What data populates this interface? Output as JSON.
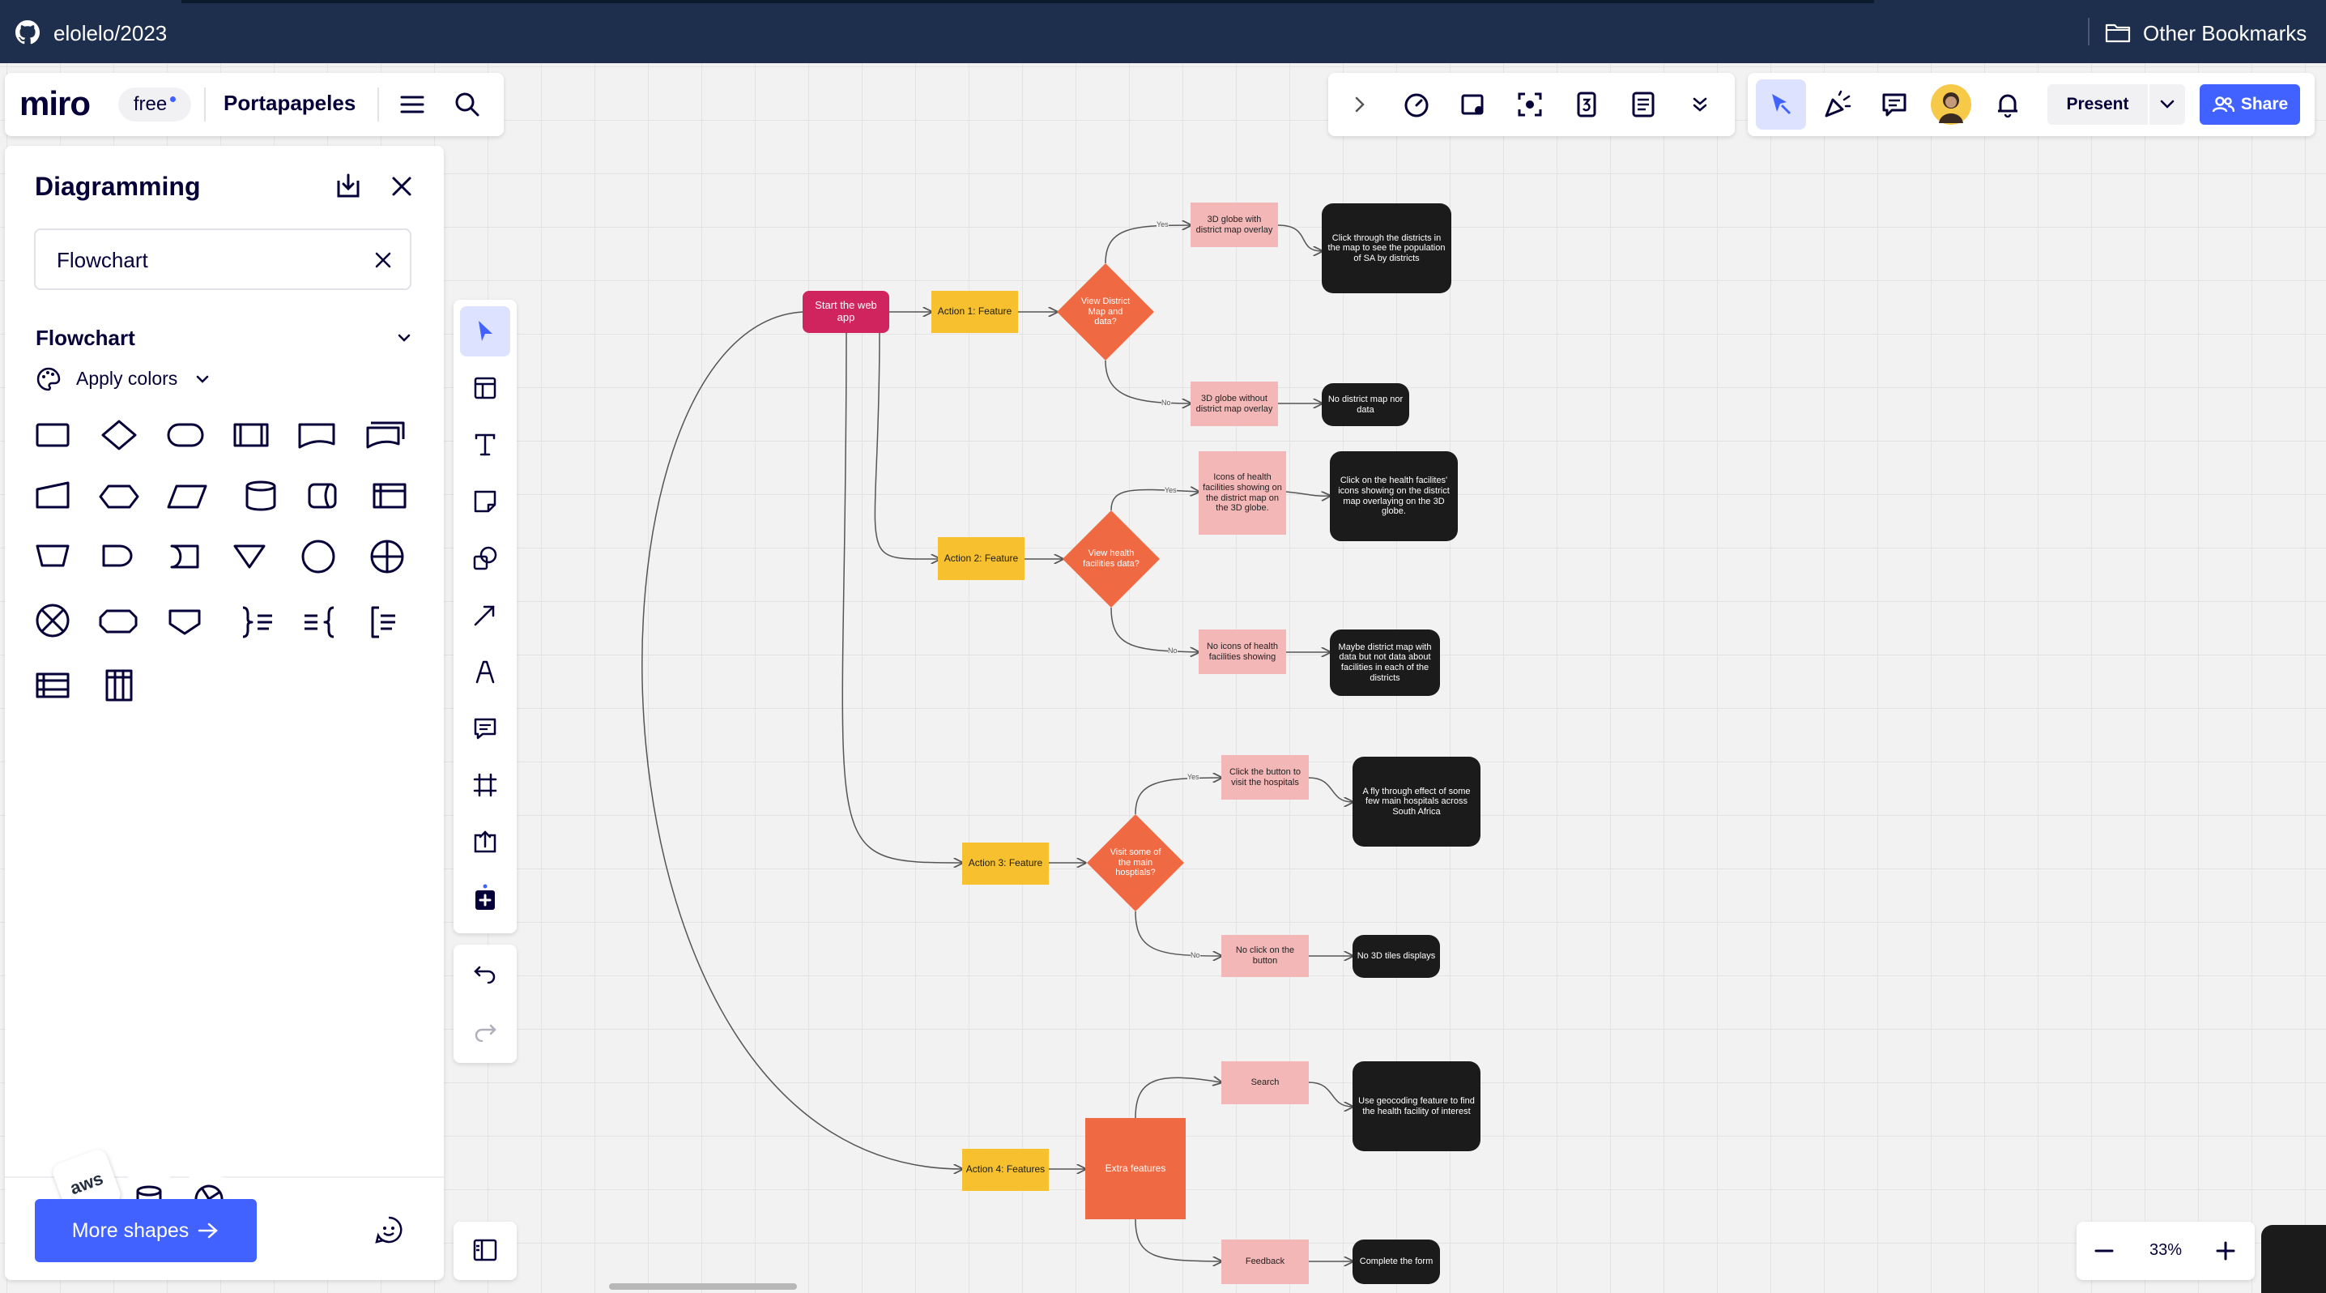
{
  "browser": {
    "repo": "elolelo/2023",
    "other_bookmarks": "Other Bookmarks"
  },
  "miro": {
    "logo": "miro",
    "plan_badge": "free",
    "board_name": "Portapapeles"
  },
  "toolbar": {
    "present": "Present",
    "share": "Share"
  },
  "sidebar": {
    "title": "Diagramming",
    "search_value": "Flowchart",
    "section": "Flowchart",
    "apply_colors": "Apply colors",
    "more_shapes": "More shapes",
    "aws_label": "aws"
  },
  "zoom": {
    "level": "33%"
  },
  "colors": {
    "start": "#d0245e",
    "action": "#f6c02f",
    "decision": "#ef6a43",
    "result": "#f4b7b7",
    "outcome": "#1b1b1b",
    "accent": "#4262ff"
  },
  "flow": {
    "start": "Start the web app",
    "action1": "Action 1: Feature",
    "action2": "Action 2: Feature",
    "action3": "Action 3: Feature",
    "action4": "Action 4: Features",
    "decision1": "View District Map and data?",
    "decision2": "View health facilities data?",
    "decision3": "Visit some of the main hosptials?",
    "extra": "Extra features",
    "yes": "Yes",
    "no": "No",
    "r1_yes": "3D globe with district map overlay",
    "r1_no": "3D globe without district map overlay",
    "o1_yes": "Click through the districts in the map to see the population of SA by districts",
    "o1_no": "No district map nor data",
    "r2_yes": "Icons of health facilities showing on the district map on the 3D globe.",
    "r2_no": "No icons of health facilities showing",
    "o2_yes": "Click on the health facilites' icons showing on the district map overlaying on the 3D globe.",
    "o2_no": "Maybe district map with data but not data about facilities in each of the districts",
    "r3_yes": "Click the button to visit the hospitals",
    "r3_no": "No click on the button",
    "o3_yes": "A fly through effect of some few main hospitals across South Africa",
    "o3_no": "No 3D tiles displays",
    "r4_search": "Search",
    "r4_feedback": "Feedback",
    "o4_search": "Use geocoding feature to find the health facility of interest",
    "o4_feedback": "Complete the form"
  }
}
